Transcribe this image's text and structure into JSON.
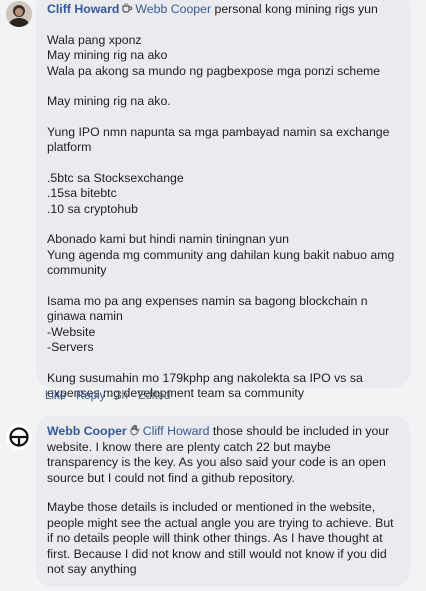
{
  "comment1": {
    "author": "Cliff Howard",
    "author_icon": "coffee-emoji",
    "mention": "Webb Cooper",
    "lead_text": " personal kong mining rigs yun",
    "paragraphs": [
      "Wala pang xponz\nMay mining rig na ako\nWala pa akong sa mundo ng pagbexpose mga ponzi scheme",
      "May mining rig na ako.",
      "Yung IPO nmn napunta sa mga pambayad namin sa exchange platform",
      ".5btc sa Stocksexchange\n.15sa bitebtc\n.10 sa cryptohub",
      "Abonado kami but hindi namin tiningnan yun\nYung agenda mg community ang dahilan kung bakit nabuo amg community",
      "Isama mo pa ang expenses namin sa bagong blockchain n ginawa namin\n-Website\n-Servers",
      "Kung susumahin mo 179kphp ang nakolekta sa IPO vs sa expenses mg development team sa community"
    ],
    "actions": {
      "like": "Like",
      "reply": "Reply",
      "time": "3h",
      "edited": "Edited"
    }
  },
  "comment2": {
    "author": "Webb Cooper",
    "author_icon": "waving-hand-emoji",
    "mention": "Cliff Howard",
    "lead_text": " those should be included in your website. I know there are plenty catch 22 but maybe transparency is the key. As you also said your code is an open source but I could not find a github repository.",
    "paragraphs": [
      "Maybe those details is included or mentioned in the website, people might see the actual angle you are trying to achieve. But if no details people will think other things. As I have thought at first. Because I did not know and still would not know if you did not say anything"
    ]
  },
  "colors": {
    "bubble": "#e9ebee",
    "link": "#385898",
    "background": "#f2f3f5"
  }
}
